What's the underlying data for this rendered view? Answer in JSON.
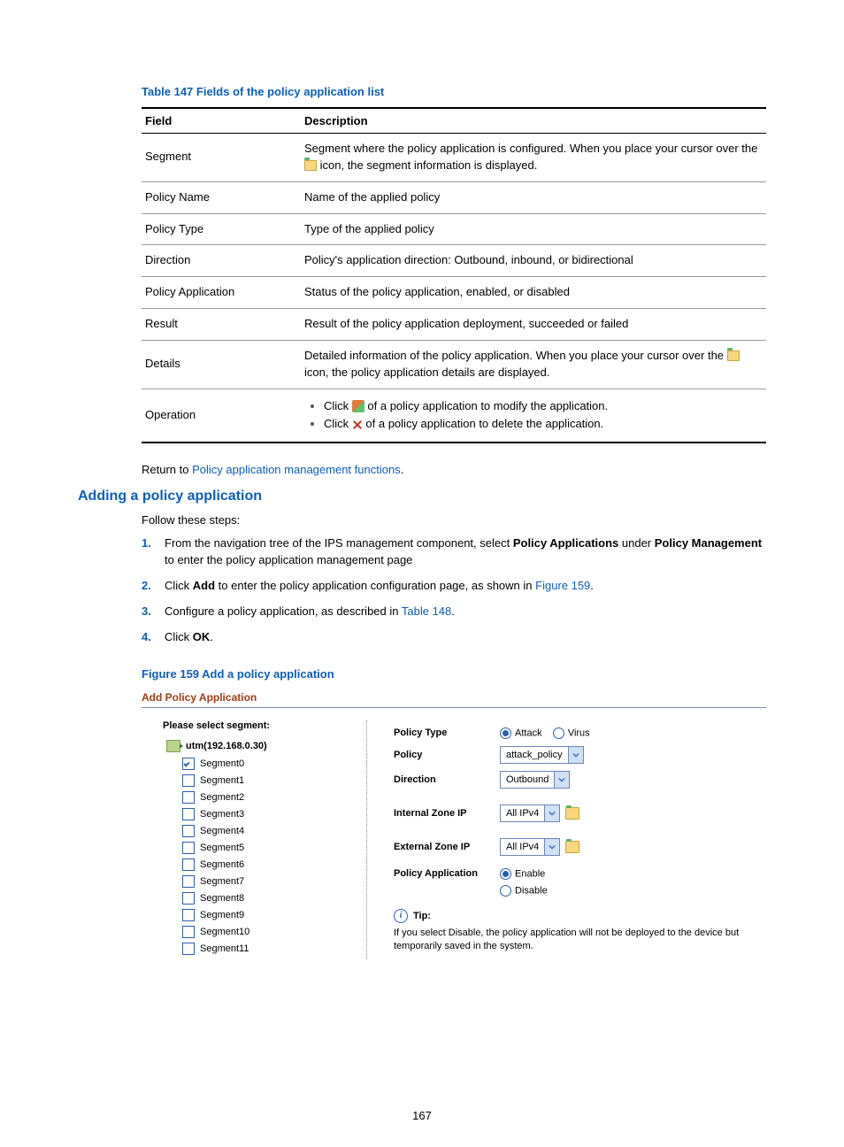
{
  "table": {
    "caption": "Table 147 Fields of the policy application list",
    "head_field": "Field",
    "head_desc": "Description",
    "rows": {
      "segment": {
        "field": "Segment",
        "desc_a": "Segment where the policy application is configured. When you place your cursor over the ",
        "desc_b": " icon, the segment information is displayed."
      },
      "policyname": {
        "field": "Policy Name",
        "desc": "Name of the applied policy"
      },
      "policytype": {
        "field": "Policy Type",
        "desc": "Type of the applied policy"
      },
      "direction": {
        "field": "Direction",
        "desc": "Policy's application direction: Outbound, inbound, or bidirectional"
      },
      "policyapp": {
        "field": "Policy Application",
        "desc": "Status of the policy application, enabled, or disabled"
      },
      "result": {
        "field": "Result",
        "desc": "Result of the policy application deployment, succeeded or failed"
      },
      "details": {
        "field": "Details",
        "desc_a": "Detailed information of the policy application. When you place your cursor over the ",
        "desc_b": " icon, the policy application details are displayed."
      },
      "operation": {
        "field": "Operation",
        "op1a": "Click ",
        "op1b": " of a policy application to modify the application.",
        "op2a": "Click ",
        "op2b": " of a policy application to delete the application."
      }
    }
  },
  "return": {
    "pre": "Return to ",
    "link": "Policy application management functions",
    "post": "."
  },
  "heading2": "Adding a policy application",
  "intro": "Follow these steps:",
  "steps": {
    "s1": {
      "num": "1.",
      "a": "From the navigation tree of the IPS management component, select ",
      "b": "Policy Applications",
      "c": " under ",
      "d": "Policy Management",
      "e": " to enter the policy application management page"
    },
    "s2": {
      "num": "2.",
      "a": "Click ",
      "b": "Add",
      "c": " to enter the policy application configuration page, as shown in ",
      "link": "Figure 159",
      "d": "."
    },
    "s3": {
      "num": "3.",
      "a": "Configure a policy application, as described in ",
      "link": "Table 148",
      "b": "."
    },
    "s4": {
      "num": "4.",
      "a": "Click ",
      "b": "OK",
      "c": "."
    }
  },
  "figure": {
    "caption": "Figure 159 Add a policy application",
    "form_title": "Add Policy Application",
    "seg_head": "Please select segment:",
    "device": "utm(192.168.0.30)",
    "segments": [
      "Segment0",
      "Segment1",
      "Segment2",
      "Segment3",
      "Segment4",
      "Segment5",
      "Segment6",
      "Segment7",
      "Segment8",
      "Segment9",
      "Segment10",
      "Segment11"
    ],
    "labels": {
      "policy_type": "Policy Type",
      "policy": "Policy",
      "direction": "Direction",
      "internal": "Internal Zone IP",
      "external": "External Zone IP",
      "policy_app": "Policy Application"
    },
    "values": {
      "attack": "Attack",
      "virus": "Virus",
      "policy_sel": "attack_policy",
      "direction_sel": "Outbound",
      "ip_sel": "All IPv4",
      "enable": "Enable",
      "disable": "Disable"
    },
    "tip_label": "Tip:",
    "tip_text": "If you select Disable, the policy application will not be deployed to the device but temporarily saved in the system."
  },
  "page_number": "167"
}
